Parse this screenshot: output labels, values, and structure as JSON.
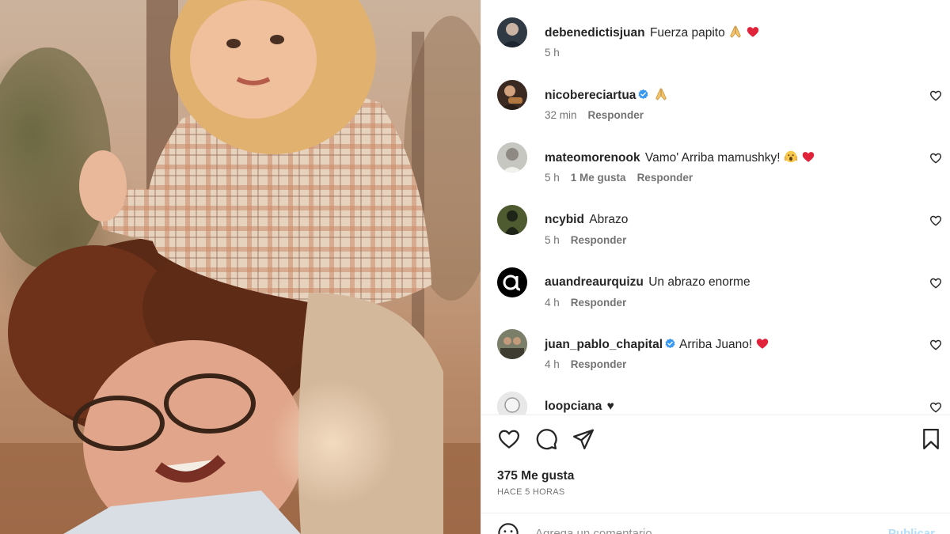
{
  "post": {
    "photo_alt": "Foto antigua: un niño rubio sobre los hombros de un hombre con anteojos"
  },
  "comments": [
    {
      "user": "debenedictisjuan",
      "verified": false,
      "text": "Fuerza papito",
      "emojis": [
        "folded-hands",
        "red-heart"
      ],
      "time": "5 h",
      "likes": "",
      "reply": "",
      "show_heart": false
    },
    {
      "user": "nicobereciartua",
      "verified": true,
      "text": "",
      "emojis": [
        "folded-hands"
      ],
      "time": "32 min",
      "likes": "",
      "reply": "Responder",
      "show_heart": true
    },
    {
      "user": "mateomorenook",
      "verified": false,
      "text": "Vamo' Arriba mamushky!",
      "emojis": [
        "scream-face",
        "red-heart"
      ],
      "time": "5 h",
      "likes": "1 Me gusta",
      "reply": "Responder",
      "show_heart": true
    },
    {
      "user": "ncybid",
      "verified": false,
      "text": "Abrazo",
      "emojis": [],
      "time": "5 h",
      "likes": "",
      "reply": "Responder",
      "show_heart": true
    },
    {
      "user": "auandreaurquizu",
      "verified": false,
      "text": "Un abrazo enorme",
      "emojis": [],
      "time": "4 h",
      "likes": "",
      "reply": "Responder",
      "show_heart": true
    },
    {
      "user": "juan_pablo_chapital",
      "verified": true,
      "text": "Arriba Juano!",
      "emojis": [
        "red-heart"
      ],
      "time": "4 h",
      "likes": "",
      "reply": "Responder",
      "show_heart": true
    },
    {
      "user": "loopciana",
      "verified": false,
      "text": "♥",
      "emojis": [],
      "time": "",
      "likes": "",
      "reply": "",
      "show_heart": true
    }
  ],
  "actions": {
    "like_icon": "heart-outline-icon",
    "comment_icon": "comment-bubble-icon",
    "share_icon": "paper-plane-icon",
    "save_icon": "bookmark-icon"
  },
  "likes_label": "375 Me gusta",
  "time_ago": "HACE 5 HORAS",
  "add_comment": {
    "placeholder": "Agrega un comentario...",
    "publish": "Publicar"
  },
  "colors": {
    "verified": "#3897f0",
    "heart": "#ed4956",
    "publish_disabled": "#b2dffc"
  }
}
